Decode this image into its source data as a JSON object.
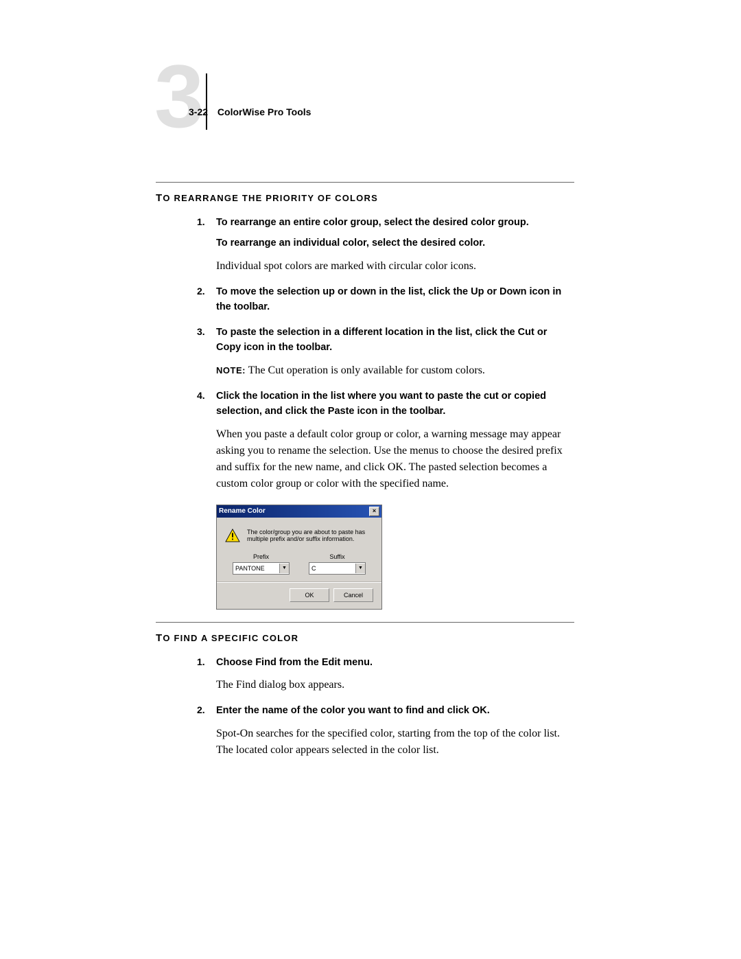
{
  "header": {
    "chapter_number": "3",
    "page_ref": "3-22",
    "title": "ColorWise Pro Tools"
  },
  "section1": {
    "first_letter": "T",
    "rest": "O REARRANGE THE PRIORITY OF COLORS",
    "steps": [
      {
        "marker": "1.",
        "bold": "To rearrange an entire color group, select the desired color group.",
        "sub": "To rearrange an individual color, select the desired color.",
        "body": "Individual spot colors are marked with circular color icons."
      },
      {
        "marker": "2.",
        "bold": "To move the selection up or down in the list, click the Up or Down icon in the toolbar."
      },
      {
        "marker": "3.",
        "bold": "To paste the selection in a different location in the list, click the Cut or Copy icon in the toolbar.",
        "note_label": "NOTE:",
        "note_body": "The Cut operation is only available for custom colors."
      },
      {
        "marker": "4.",
        "bold": "Click the location in the list where you want to paste the cut or copied selection, and click the Paste icon in the toolbar.",
        "body": "When you paste a default color group or color, a warning message may appear asking you to rename the selection. Use the menus to choose the desired prefix and suffix for the new name, and click OK. The pasted selection becomes a custom color group or color with the specified name."
      }
    ]
  },
  "dialog": {
    "title": "Rename Color",
    "message": "The color/group you are about to paste has multiple prefix and/or suffix information.",
    "prefix_label": "Prefix",
    "suffix_label": "Suffix",
    "prefix_value": "PANTONE",
    "suffix_value": "C",
    "ok": "OK",
    "cancel": "Cancel"
  },
  "section2": {
    "first_letter": "T",
    "rest": "O FIND A SPECIFIC COLOR",
    "steps": [
      {
        "marker": "1.",
        "bold": "Choose Find from the Edit menu.",
        "body": "The Find dialog box appears."
      },
      {
        "marker": "2.",
        "bold": "Enter the name of the color you want to find and click OK.",
        "body": "Spot-On searches for the specified color, starting from the top of the color list. The located color appears selected in the color list."
      }
    ]
  }
}
